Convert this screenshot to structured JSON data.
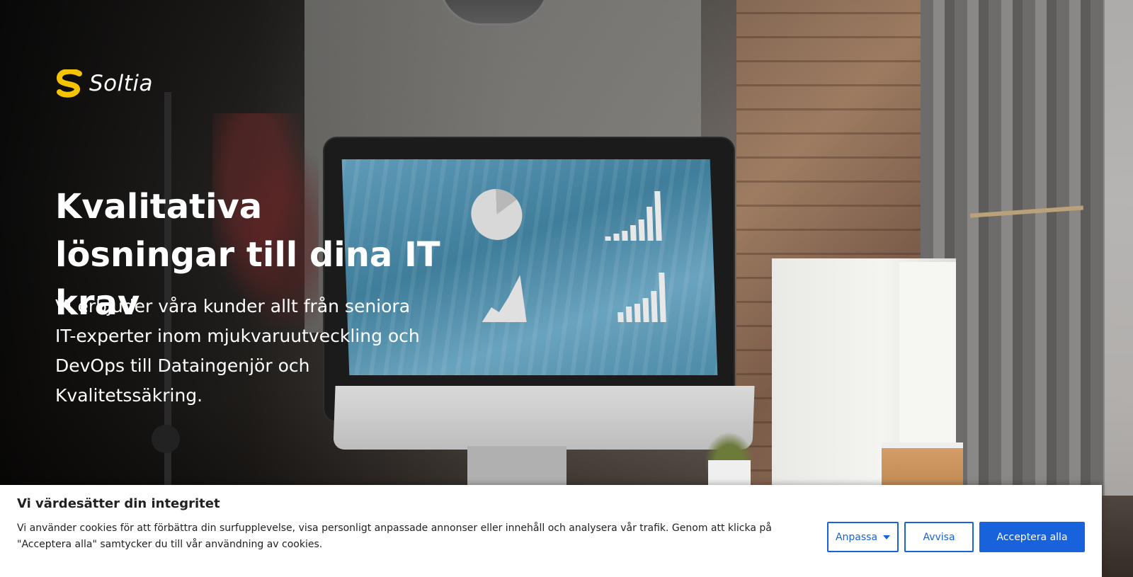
{
  "brand": {
    "name": "Soltia",
    "logo_icon": "soltia-s-logo-icon",
    "accent": "#f5c400"
  },
  "hero": {
    "headline": "Kvalitativa lösningar till dina IT krav",
    "lead": "Vi erbjuder våra kunder allt från seniora IT-experter inom mjukvaruutveckling och DevOps till Dataingenjör och Kvalitetssäkring."
  },
  "cookie_banner": {
    "title": "Vi värdesätter din integritet",
    "text": "Vi använder cookies för att förbättra din surfupplevelse, visa personligt anpassade annonser eller innehåll och analysera vår trafik. Genom att klicka på \"Acceptera alla\" samtycker du till vår användning av cookies.",
    "customize_label": "Anpassa",
    "customize_icon": "caret-down-icon",
    "reject_label": "Avvisa",
    "accept_label": "Acceptera alla",
    "button_color": "#1863dc"
  }
}
